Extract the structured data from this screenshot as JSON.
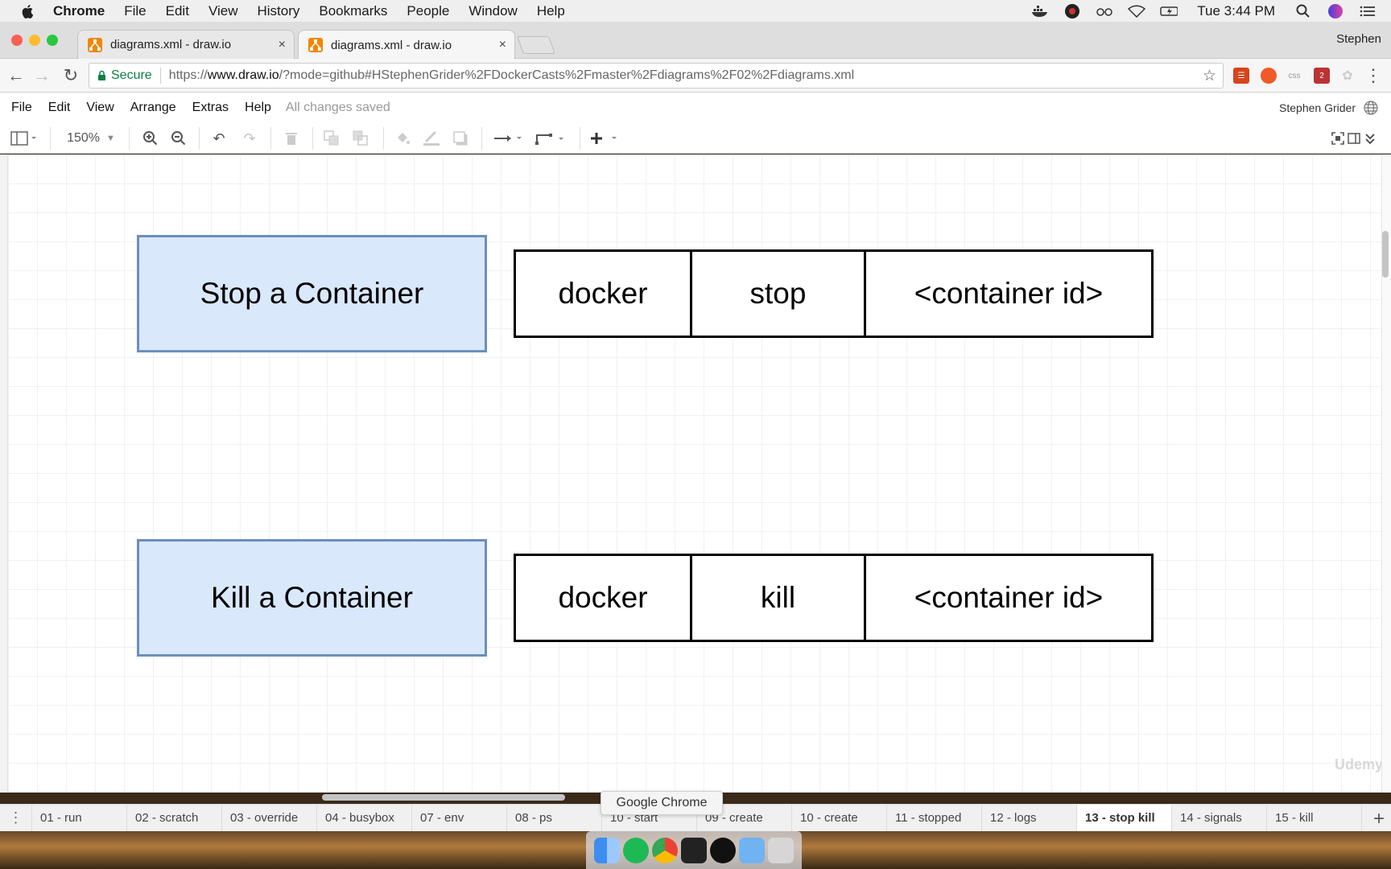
{
  "menubar": {
    "app": "Chrome",
    "items": [
      "File",
      "Edit",
      "View",
      "History",
      "Bookmarks",
      "People",
      "Window",
      "Help"
    ],
    "clock": "Tue 3:44 PM"
  },
  "tabs": [
    {
      "title": "diagrams.xml - draw.io",
      "close": "×"
    },
    {
      "title": "diagrams.xml - draw.io",
      "close": "×"
    }
  ],
  "profile": "Stephen",
  "address": {
    "secure": "Secure",
    "scheme": "https://",
    "host": "www.draw.io",
    "rest": "/?mode=github#HStephenGrider%2FDockerCasts%2Fmaster%2Fdiagrams%2F02%2Fdiagrams.xml"
  },
  "drawio": {
    "menu": [
      "File",
      "Edit",
      "View",
      "Arrange",
      "Extras",
      "Help"
    ],
    "status": "All changes saved",
    "user": "Stephen Grider",
    "zoom": "150%"
  },
  "diagram": {
    "row1": {
      "label": "Stop a Container",
      "cmd": [
        "docker",
        "stop",
        "<container id>"
      ]
    },
    "row2": {
      "label": "Kill a Container",
      "cmd": [
        "docker",
        "kill",
        "<container id>"
      ]
    }
  },
  "watermark": "Udemy",
  "tooltip": "Google Chrome",
  "pages": [
    "01 - run",
    "02 - scratch",
    "03 - override",
    "04 - busybox",
    "07 - env",
    "08 - ps",
    "10 - start",
    "09 - create",
    "10 - create",
    "11 - stopped",
    "12 - logs",
    "13 - stop kill",
    "14 - signals",
    "15 - kill"
  ],
  "active_page": "13 - stop kill",
  "colors": {
    "shape_fill": "#dae8fc",
    "shape_stroke": "#6c8ebf",
    "secure_green": "#0b8043"
  }
}
